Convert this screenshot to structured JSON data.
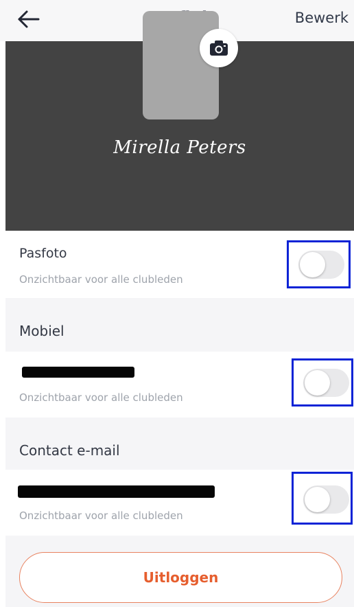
{
  "header": {
    "title": "Profiel",
    "edit_label": "Bewerk",
    "back_icon": "arrow-left-icon"
  },
  "profile": {
    "name": "Mirella Peters",
    "camera_icon": "camera-icon"
  },
  "settings": {
    "photo": {
      "title": "Pasfoto",
      "visibility": "Onzichtbaar voor alle clubleden",
      "visible_toggle_on": false
    },
    "mobile": {
      "section_label": "Mobiel",
      "value_redacted": true,
      "visibility": "Onzichtbaar voor alle clubleden",
      "visible_toggle_on": false
    },
    "email": {
      "section_label": "Contact e-mail",
      "value_redacted": true,
      "visibility": "Onzichtbaar voor alle clubleden",
      "visible_toggle_on": false
    }
  },
  "logout_label": "Uitloggen",
  "colors": {
    "header_background": "#f7f7f8",
    "profile_background": "#434343",
    "toggle_highlight": "#0a23d6",
    "logout_accent": "#e65e2e"
  }
}
